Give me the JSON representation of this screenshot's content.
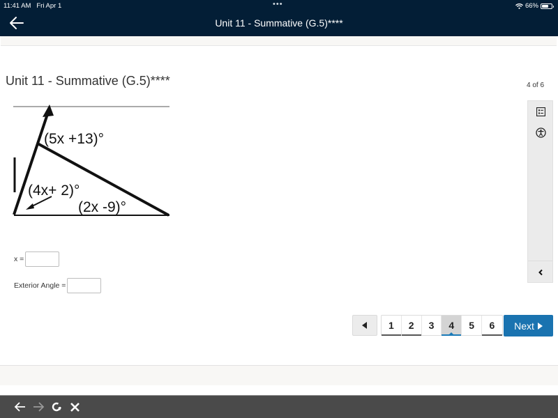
{
  "status_bar": {
    "time": "11:41 AM",
    "date": "Fri Apr 1",
    "dots": "•••",
    "battery_percent": "66%",
    "battery_level": 0.66
  },
  "header": {
    "back_icon": "arrow-left-icon",
    "title": "Unit 11 - Summative (G.5)****"
  },
  "main": {
    "page_title": "Unit 11 - Summative (G.5)****",
    "progress_text": "4 of 6",
    "diagram": {
      "angle_exterior": "(5x +13)°",
      "angle_left": "(4x+ 2)°",
      "angle_right": "(2x -9)°"
    },
    "fields": [
      {
        "label": "x =",
        "value": "",
        "placeholder": ""
      },
      {
        "label": "Exterior Angle =",
        "value": "",
        "placeholder": ""
      }
    ]
  },
  "side_panel": {
    "icons": [
      "checklist-icon",
      "accessibility-icon"
    ],
    "collapse_icon": "chevron-left-icon"
  },
  "pagination": {
    "prev_icon": "triangle-left-icon",
    "pages": [
      {
        "label": "1",
        "state": "visited"
      },
      {
        "label": "2",
        "state": "visited"
      },
      {
        "label": "3",
        "state": "unvisited"
      },
      {
        "label": "4",
        "state": "current"
      },
      {
        "label": "5",
        "state": "unvisited"
      },
      {
        "label": "6",
        "state": "visited"
      }
    ],
    "next_label": "Next",
    "accent_color": "#1a73b0"
  },
  "browser_bar": {
    "buttons": [
      "back-icon",
      "forward-icon",
      "reload-icon",
      "close-icon"
    ]
  }
}
